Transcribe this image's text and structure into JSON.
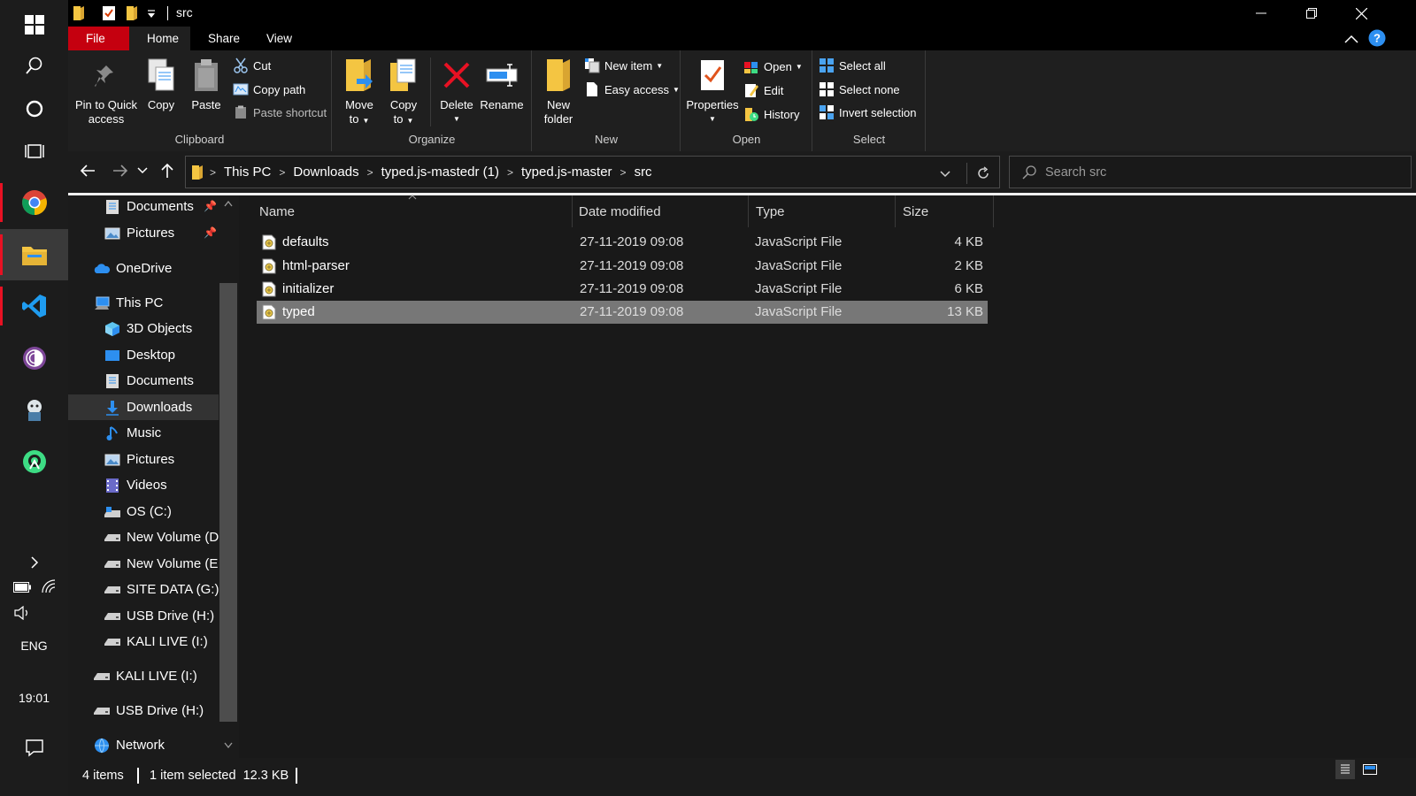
{
  "window": {
    "title": "src",
    "controls": {
      "minimize": "—",
      "restore": "❐",
      "close": "✕"
    }
  },
  "ribbon_tabs": [
    "File",
    "Home",
    "Share",
    "View"
  ],
  "ribbon": {
    "clipboard": {
      "label": "Clipboard",
      "pin": "Pin to Quick access",
      "pin_line1": "Pin to Quick",
      "pin_line2": "access",
      "copy": "Copy",
      "paste": "Paste",
      "cut": "Cut",
      "copy_path": "Copy path",
      "paste_shortcut": "Paste shortcut"
    },
    "organize": {
      "label": "Organize",
      "move_to_line1": "Move",
      "move_to_line2": "to",
      "copy_to_line1": "Copy",
      "copy_to_line2": "to",
      "delete": "Delete",
      "rename": "Rename"
    },
    "new": {
      "label": "New",
      "new_folder_line1": "New",
      "new_folder_line2": "folder",
      "new_item": "New item",
      "easy_access": "Easy access"
    },
    "open": {
      "label": "Open",
      "properties": "Properties",
      "open": "Open",
      "edit": "Edit",
      "history": "History"
    },
    "select": {
      "label": "Select",
      "select_all": "Select all",
      "select_none": "Select none",
      "invert_selection": "Invert selection"
    }
  },
  "address": {
    "crumbs": [
      "This PC",
      "Downloads",
      "typed.js-mastedr (1)",
      "typed.js-master",
      "src"
    ]
  },
  "search": {
    "placeholder": "Search src"
  },
  "nav_pane": {
    "items": [
      {
        "label": "Documents",
        "icon": "documents-icon",
        "pinned": true
      },
      {
        "label": "Pictures",
        "icon": "pictures-icon",
        "pinned": true
      },
      {
        "label": "OneDrive",
        "icon": "cloud-icon"
      },
      {
        "label": "This PC",
        "icon": "computer-icon"
      },
      {
        "label": "3D Objects",
        "icon": "cube-icon"
      },
      {
        "label": "Desktop",
        "icon": "desktop-icon"
      },
      {
        "label": "Documents",
        "icon": "documents-icon"
      },
      {
        "label": "Downloads",
        "icon": "download-icon",
        "selected": true
      },
      {
        "label": "Music",
        "icon": "music-icon"
      },
      {
        "label": "Pictures",
        "icon": "pictures-icon"
      },
      {
        "label": "Videos",
        "icon": "videos-icon"
      },
      {
        "label": "OS (C:)",
        "icon": "drive-icon"
      },
      {
        "label": "New Volume (D:)",
        "icon": "drive-icon"
      },
      {
        "label": "New Volume (E:)",
        "icon": "drive-icon"
      },
      {
        "label": "SITE DATA (G:)",
        "icon": "drive-icon"
      },
      {
        "label": "USB Drive (H:)",
        "icon": "drive-icon"
      },
      {
        "label": "KALI LIVE (I:)",
        "icon": "drive-icon"
      },
      {
        "label": "KALI LIVE (I:)",
        "icon": "drive-icon"
      },
      {
        "label": "USB Drive (H:)",
        "icon": "drive-icon"
      },
      {
        "label": "Network",
        "icon": "network-icon"
      }
    ]
  },
  "columns": [
    "Name",
    "Date modified",
    "Type",
    "Size"
  ],
  "files": [
    {
      "name": "defaults",
      "date": "27-11-2019 09:08",
      "type": "JavaScript File",
      "size": "4 KB"
    },
    {
      "name": "html-parser",
      "date": "27-11-2019 09:08",
      "type": "JavaScript File",
      "size": "2 KB"
    },
    {
      "name": "initializer",
      "date": "27-11-2019 09:08",
      "type": "JavaScript File",
      "size": "6 KB"
    },
    {
      "name": "typed",
      "date": "27-11-2019 09:08",
      "type": "JavaScript File",
      "size": "13 KB",
      "selected": true
    }
  ],
  "status": {
    "item_count": "4 items",
    "selection": "1 item selected  12.3 KB"
  },
  "taskbar": {
    "language": "ENG",
    "time": "19:01"
  },
  "colors": {
    "file_tab": "#c5000f",
    "selection": "#777777",
    "ribbon_bg": "#1f1f1f",
    "delete_red": "#e81123",
    "folder_yellow": "#f4c542",
    "accent_blue": "#2d8ff0"
  }
}
